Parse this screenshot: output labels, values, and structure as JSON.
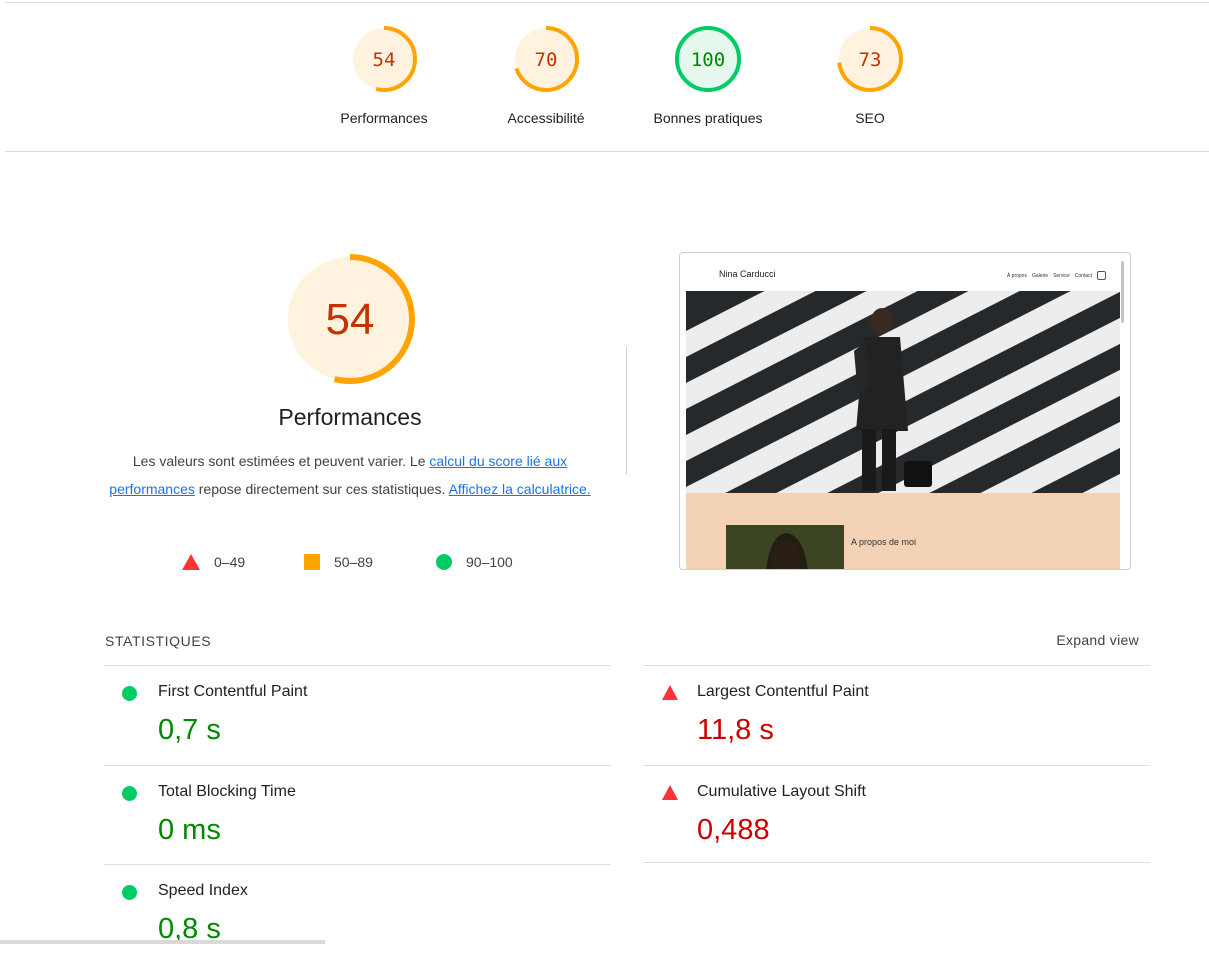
{
  "categories": [
    {
      "label": "Performances",
      "score": 54,
      "status": "average"
    },
    {
      "label": "Accessibilité",
      "score": 70,
      "status": "average"
    },
    {
      "label": "Bonnes pratiques",
      "score": 100,
      "status": "pass"
    },
    {
      "label": "SEO",
      "score": 73,
      "status": "average"
    }
  ],
  "colors": {
    "fail": "#ff3333",
    "average": "#ffa400",
    "pass": "#00cc66",
    "average_text": "#c33300",
    "pass_text": "#008800"
  },
  "main": {
    "score": 54,
    "title": "Performances",
    "desc_pre": "Les valeurs sont estimées et peuvent varier. Le ",
    "desc_link1": "calcul du score lié aux performances",
    "desc_mid": " repose directement sur ces statistiques. ",
    "desc_link2": "Affichez la calculatrice."
  },
  "legend": {
    "fail": "0–49",
    "average": "50–89",
    "pass": "90–100"
  },
  "screenshot": {
    "brand": "Nina Carducci",
    "nav": [
      "À propos",
      "Galerie",
      "Service",
      "Contact"
    ],
    "about": "A propos de moi"
  },
  "stats": {
    "title": "STATISTIQUES",
    "expand": "Expand view",
    "metrics": [
      {
        "name": "First Contentful Paint",
        "value": "0,7 s",
        "status": "pass"
      },
      {
        "name": "Largest Contentful Paint",
        "value": "11,8 s",
        "status": "fail"
      },
      {
        "name": "Total Blocking Time",
        "value": "0 ms",
        "status": "pass"
      },
      {
        "name": "Cumulative Layout Shift",
        "value": "0,488",
        "status": "fail"
      },
      {
        "name": "Speed Index",
        "value": "0,8 s",
        "status": "pass"
      }
    ]
  }
}
